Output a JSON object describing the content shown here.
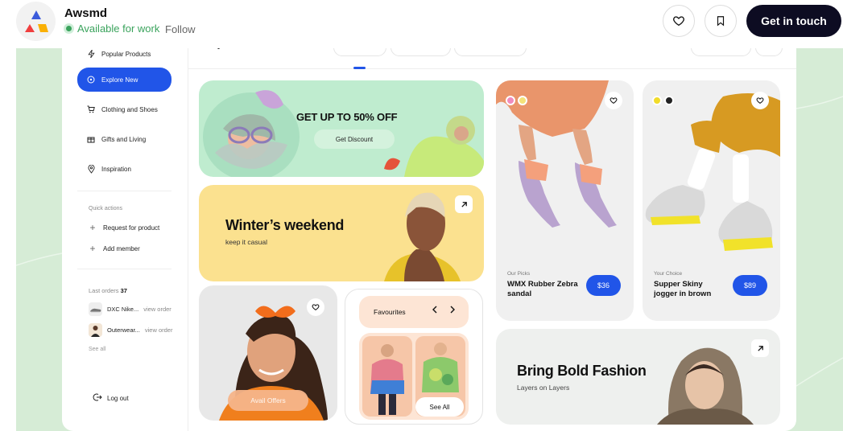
{
  "header": {
    "app_name": "Awsmd",
    "availability": "Available for work",
    "follow_label": "Follow",
    "cta_label": "Get in touch",
    "icons": [
      "heart-icon",
      "bookmark-icon"
    ]
  },
  "sidebar": {
    "top_item": "Popular Products",
    "items": [
      {
        "label": "Explore New",
        "icon": "compass-icon",
        "active": true
      },
      {
        "label": "Clothing and  Shoes",
        "icon": "cart-icon"
      },
      {
        "label": "Gifts and Living",
        "icon": "gift-icon"
      },
      {
        "label": "Inspiration",
        "icon": "location-icon"
      }
    ],
    "quick_actions_title": "Quick actions",
    "quick_actions": [
      "Request for product",
      "Add member"
    ],
    "last_orders_label": "Last  orders",
    "last_orders_count": "37",
    "orders": [
      {
        "name": "DXC Nike...",
        "action": "view order"
      },
      {
        "name": "Outerwear...",
        "action": "view order"
      }
    ],
    "see_all": "See all",
    "logout": "Log out"
  },
  "promo": {
    "title": "GET UP TO 50% OFF",
    "button": "Get Discount"
  },
  "winter": {
    "title": "Winter’s weekend",
    "subtitle": "keep it casual"
  },
  "portrait": {
    "button": "Avail Offers"
  },
  "favourites": {
    "title": "Favourites",
    "see_all": "See All"
  },
  "products": [
    {
      "category": "Our Picks",
      "name": "WMX Rubber Zebra sandal",
      "price": "$36",
      "swatches": [
        "#f08bbd",
        "#f4e37a"
      ]
    },
    {
      "category": "Your Choice",
      "name": "Supper Skiny jogger in brown",
      "price": "$89",
      "swatches": [
        "#f1dc2a",
        "#222222"
      ]
    }
  ],
  "bold": {
    "title": "Bring Bold Fashion",
    "subtitle": "Layers on Layers"
  },
  "colors": {
    "accent": "#2155e8",
    "cta": "#0d0c22",
    "available": "#3aa35c",
    "background": "#d6ecd6"
  }
}
